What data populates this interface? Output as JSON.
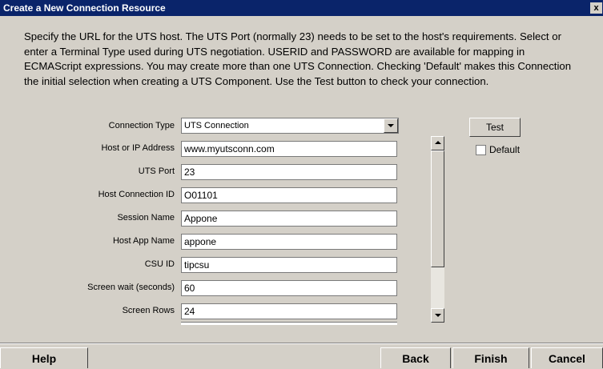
{
  "window": {
    "title": "Create a New Connection Resource",
    "close_glyph": "x"
  },
  "description": "Specify the URL for the UTS host.  The UTS Port (normally 23) needs to be set to the host's requirements. Select or enter a Terminal Type used during UTS negotiation.  USERID and PASSWORD are available for mapping in ECMAScript expressions.  You may create more than one UTS Connection.  Checking 'Default' makes this Connection the initial selection when creating a UTS Component.  Use the Test button to check your connection.",
  "form": {
    "connection_type": {
      "label": "Connection Type",
      "value": "UTS Connection"
    },
    "host": {
      "label": "Host or IP Address",
      "value": "www.myutsconn.com"
    },
    "port": {
      "label": "UTS Port",
      "value": "23"
    },
    "host_connection_id": {
      "label": "Host Connection ID",
      "value": "O01101"
    },
    "session_name": {
      "label": "Session Name",
      "value": "Appone"
    },
    "host_app_name": {
      "label": "Host App Name",
      "value": "appone"
    },
    "csu_id": {
      "label": "CSU ID",
      "value": "tipcsu"
    },
    "screen_wait": {
      "label": "Screen wait (seconds)",
      "value": "60"
    },
    "screen_rows": {
      "label": "Screen Rows",
      "value": "24"
    }
  },
  "side": {
    "test_label": "Test",
    "default_label": "Default",
    "default_checked": false
  },
  "footer": {
    "help": "Help",
    "back": "Back",
    "finish": "Finish",
    "cancel": "Cancel"
  },
  "colors": {
    "titlebar": "#0a246a",
    "dialog_bg": "#d4d0c8"
  }
}
